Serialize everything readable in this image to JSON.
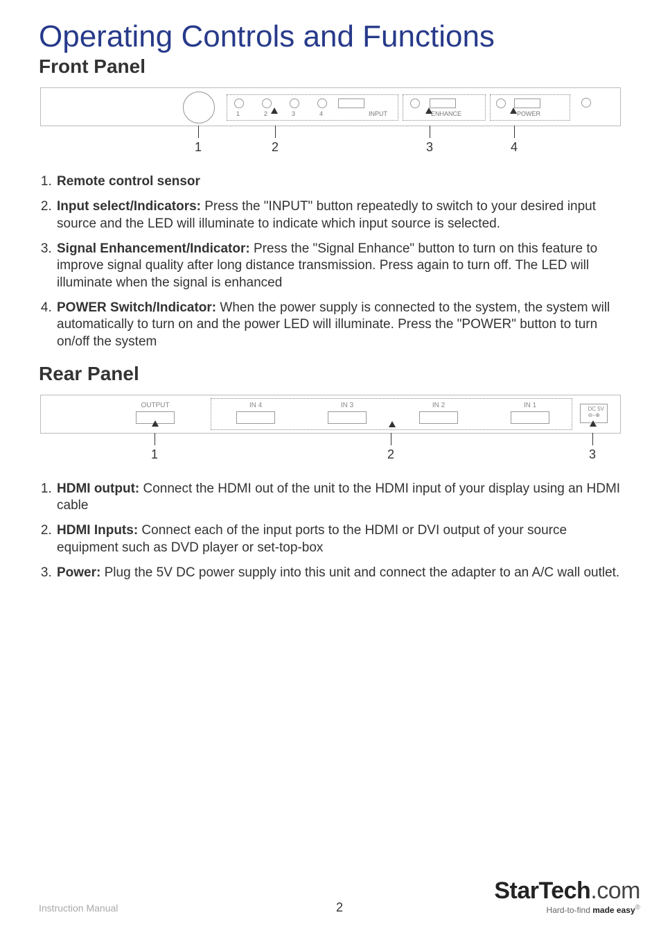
{
  "title": "Operating Controls and Functions",
  "section_front": "Front Panel",
  "section_rear": "Rear Panel",
  "front_diagram": {
    "inside_labels": {
      "led1": "1",
      "led2": "2",
      "led3": "3",
      "led4": "4",
      "input": "INPUT",
      "enhance": "ENHANCE",
      "power": "POWER"
    },
    "callouts": {
      "c1": "1",
      "c2": "2",
      "c3": "3",
      "c4": "4"
    }
  },
  "front_list": {
    "i1_lead": "Remote control sensor",
    "i2_lead": "Input select/Indicators:",
    "i2_body": " Press the \"INPUT\" button repeatedly to switch to your desired input source and the LED will illuminate to indicate which input source is selected.",
    "i3_lead": "Signal Enhancement/Indicator:",
    "i3_body": " Press the \"Signal Enhance\" button to turn on this feature to improve signal quality after long distance transmission. Press again to turn off. The LED will illuminate when the signal is enhanced",
    "i4_lead": "POWER Switch/Indicator:",
    "i4_body": " When the power supply is connected to the system, the system will automatically to turn on and the power LED will illuminate. Press the \"POWER\" button to turn on/off the system"
  },
  "rear_diagram": {
    "labels": {
      "output": "OUTPUT",
      "in4": "IN 4",
      "in3": "IN 3",
      "in2": "IN 2",
      "in1": "IN 1",
      "dc": "DC 5V",
      "polarity": "⊖⎯⊕"
    },
    "callouts": {
      "c1": "1",
      "c2": "2",
      "c3": "3"
    }
  },
  "rear_list": {
    "i1_lead": "HDMI output:",
    "i1_body": " Connect the HDMI out of the unit to the HDMI input of your display using an HDMI cable",
    "i2_lead": "HDMI Inputs:",
    "i2_body": " Connect each of the input ports to the HDMI or DVI output of your source equipment such as DVD player or set-top-box",
    "i3_lead": "Power:",
    "i3_body": " Plug the 5V DC power supply into this unit and connect the adapter to an A/C wall outlet."
  },
  "footer": {
    "instruction_manual": "Instruction Manual",
    "page_number": "2",
    "brand_main": "StarTech",
    "brand_suffix": ".com",
    "tagline_pre": "Hard-to-find ",
    "tagline_bold": "made easy"
  }
}
